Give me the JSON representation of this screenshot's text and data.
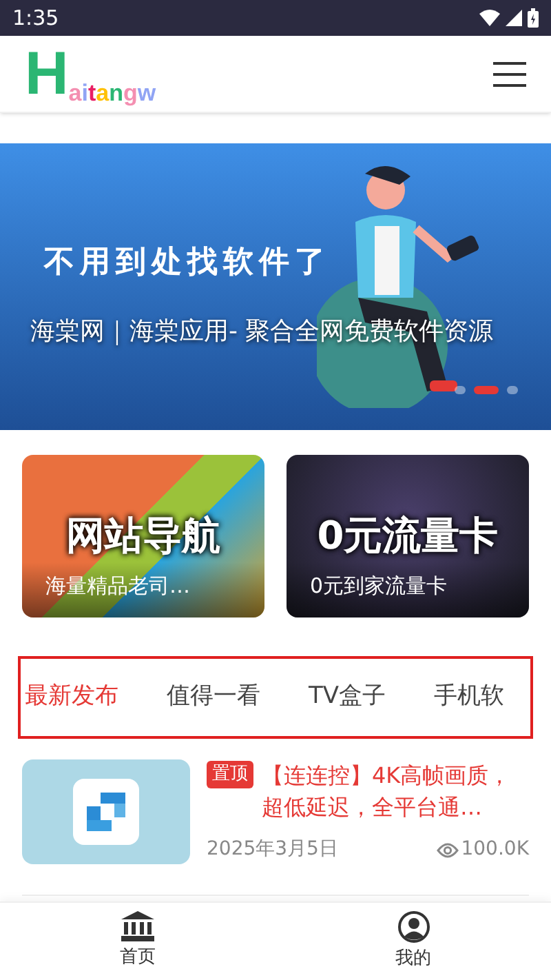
{
  "status_bar": {
    "time": "1:35"
  },
  "header": {
    "logo": [
      {
        "text": "H",
        "color": "#2bb673"
      },
      {
        "text": "a",
        "color": "#f48fb1"
      },
      {
        "text": "i",
        "color": "#90a4f4"
      },
      {
        "text": "t",
        "color": "#e91e63"
      },
      {
        "text": "a",
        "color": "#ffc107"
      },
      {
        "text": "n",
        "color": "#2bb673"
      },
      {
        "text": "g",
        "color": "#f48fb1"
      },
      {
        "text": "w",
        "color": "#90a4f4"
      }
    ]
  },
  "banner": {
    "headline": "不用到处找软件了",
    "caption": "海棠网｜海棠应用- 聚合全网免费软件资源",
    "dots": [
      {
        "selected": false
      },
      {
        "selected": true
      },
      {
        "selected": false
      }
    ]
  },
  "cards": [
    {
      "kind": "colorful",
      "title": "网站导航",
      "subtitle": "海量精品老司…"
    },
    {
      "kind": "dark",
      "title": "0元流量卡",
      "subtitle": "0元到家流量卡"
    }
  ],
  "tabs": [
    {
      "label": "最新发布",
      "selected": true
    },
    {
      "label": "值得一看",
      "selected": false
    },
    {
      "label": "TV盒子",
      "selected": false
    },
    {
      "label": "手机软",
      "selected": false
    }
  ],
  "posts": [
    {
      "badge": "置顶",
      "title": "【连连控】4K高帧画质，超低延迟，全平台通…",
      "date": "2025年3月5日",
      "views": "100.0K"
    }
  ],
  "bottom_nav": [
    {
      "kind": "home",
      "label": "首页"
    },
    {
      "kind": "profile",
      "label": "我的"
    }
  ]
}
